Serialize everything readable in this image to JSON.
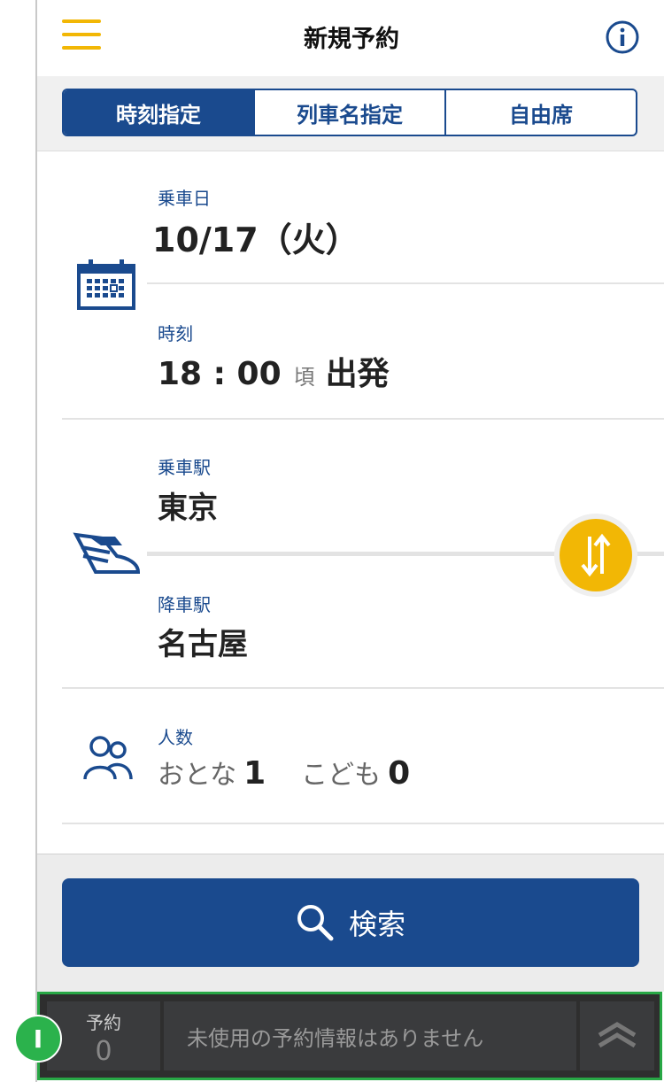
{
  "header": {
    "title": "新規予約"
  },
  "tabs": [
    {
      "label": "時刻指定",
      "selected": true
    },
    {
      "label": "列車名指定",
      "selected": false
    },
    {
      "label": "自由席",
      "selected": false
    }
  ],
  "date": {
    "label": "乗車日",
    "value": "10/17（火）"
  },
  "time": {
    "label": "時刻",
    "value": "18 : 00",
    "approx": "頃",
    "mode": "出発"
  },
  "from": {
    "label": "乗車駅",
    "value": "東京"
  },
  "to": {
    "label": "降車駅",
    "value": "名古屋"
  },
  "passengers": {
    "label": "人数",
    "adult_label": "おとな",
    "adult_count": "1",
    "child_label": "こども",
    "child_count": "0"
  },
  "search": {
    "label": "検索"
  },
  "bottom_bar": {
    "reservation_label": "予約",
    "reservation_count": "0",
    "message": "未使用の予約情報はありません",
    "badge": "I"
  },
  "colors": {
    "primary": "#1a4a8e",
    "accent": "#f2b705",
    "highlight": "#28a745"
  },
  "icons": [
    "menu-icon",
    "info-icon",
    "calendar-icon",
    "train-icon",
    "swap-icon",
    "people-icon",
    "search-icon",
    "chevron-up-icon"
  ]
}
